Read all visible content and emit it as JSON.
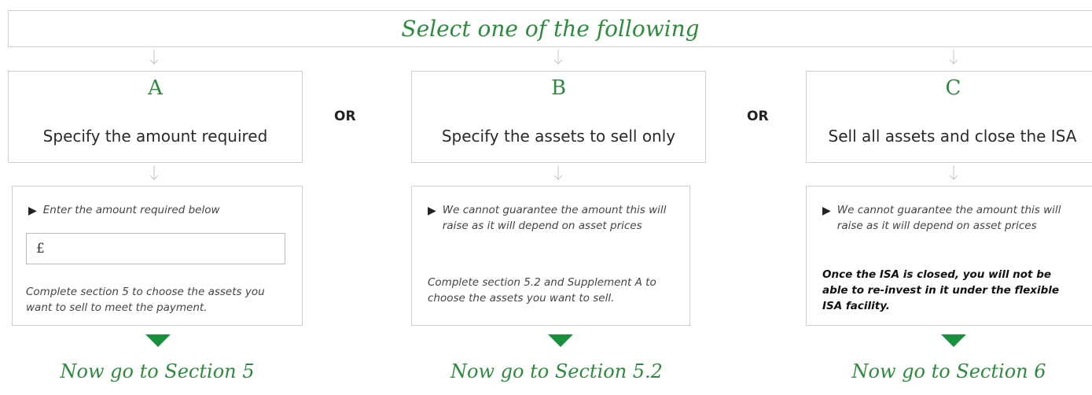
{
  "header": {
    "title": "Select one of the following"
  },
  "separator_label": "OR",
  "options": [
    {
      "letter": "A",
      "description": "Specify the amount required",
      "bullet": "Enter the amount required below",
      "currency_symbol": "£",
      "note": "Complete section 5 to choose the assets you want to sell to meet the payment.",
      "goto": "Now go to Section 5"
    },
    {
      "letter": "B",
      "description": "Specify the assets to sell only",
      "bullet": "We cannot guarantee the amount this will raise as it will depend on asset prices",
      "note": "Complete section 5.2 and Supplement A to choose the assets you want to sell.",
      "goto": "Now go to Section 5.2"
    },
    {
      "letter": "C",
      "description": "Sell all assets and close the ISA",
      "bullet": "We cannot guarantee the amount this will raise as it will depend on asset prices",
      "note": "Once the ISA is closed, you will not be able to re-invest in it under the flexible ISA facility.",
      "goto": "Now go to Section 6"
    }
  ],
  "icons": {
    "bullet": "triangle-right-icon",
    "connector": "arrow-down-icon",
    "proceed": "green-triangle-down-icon"
  },
  "colors": {
    "accent_green": "#2e8b3e",
    "triangle_green": "#1a8f3c",
    "border_grey": "#cfcfcf"
  }
}
